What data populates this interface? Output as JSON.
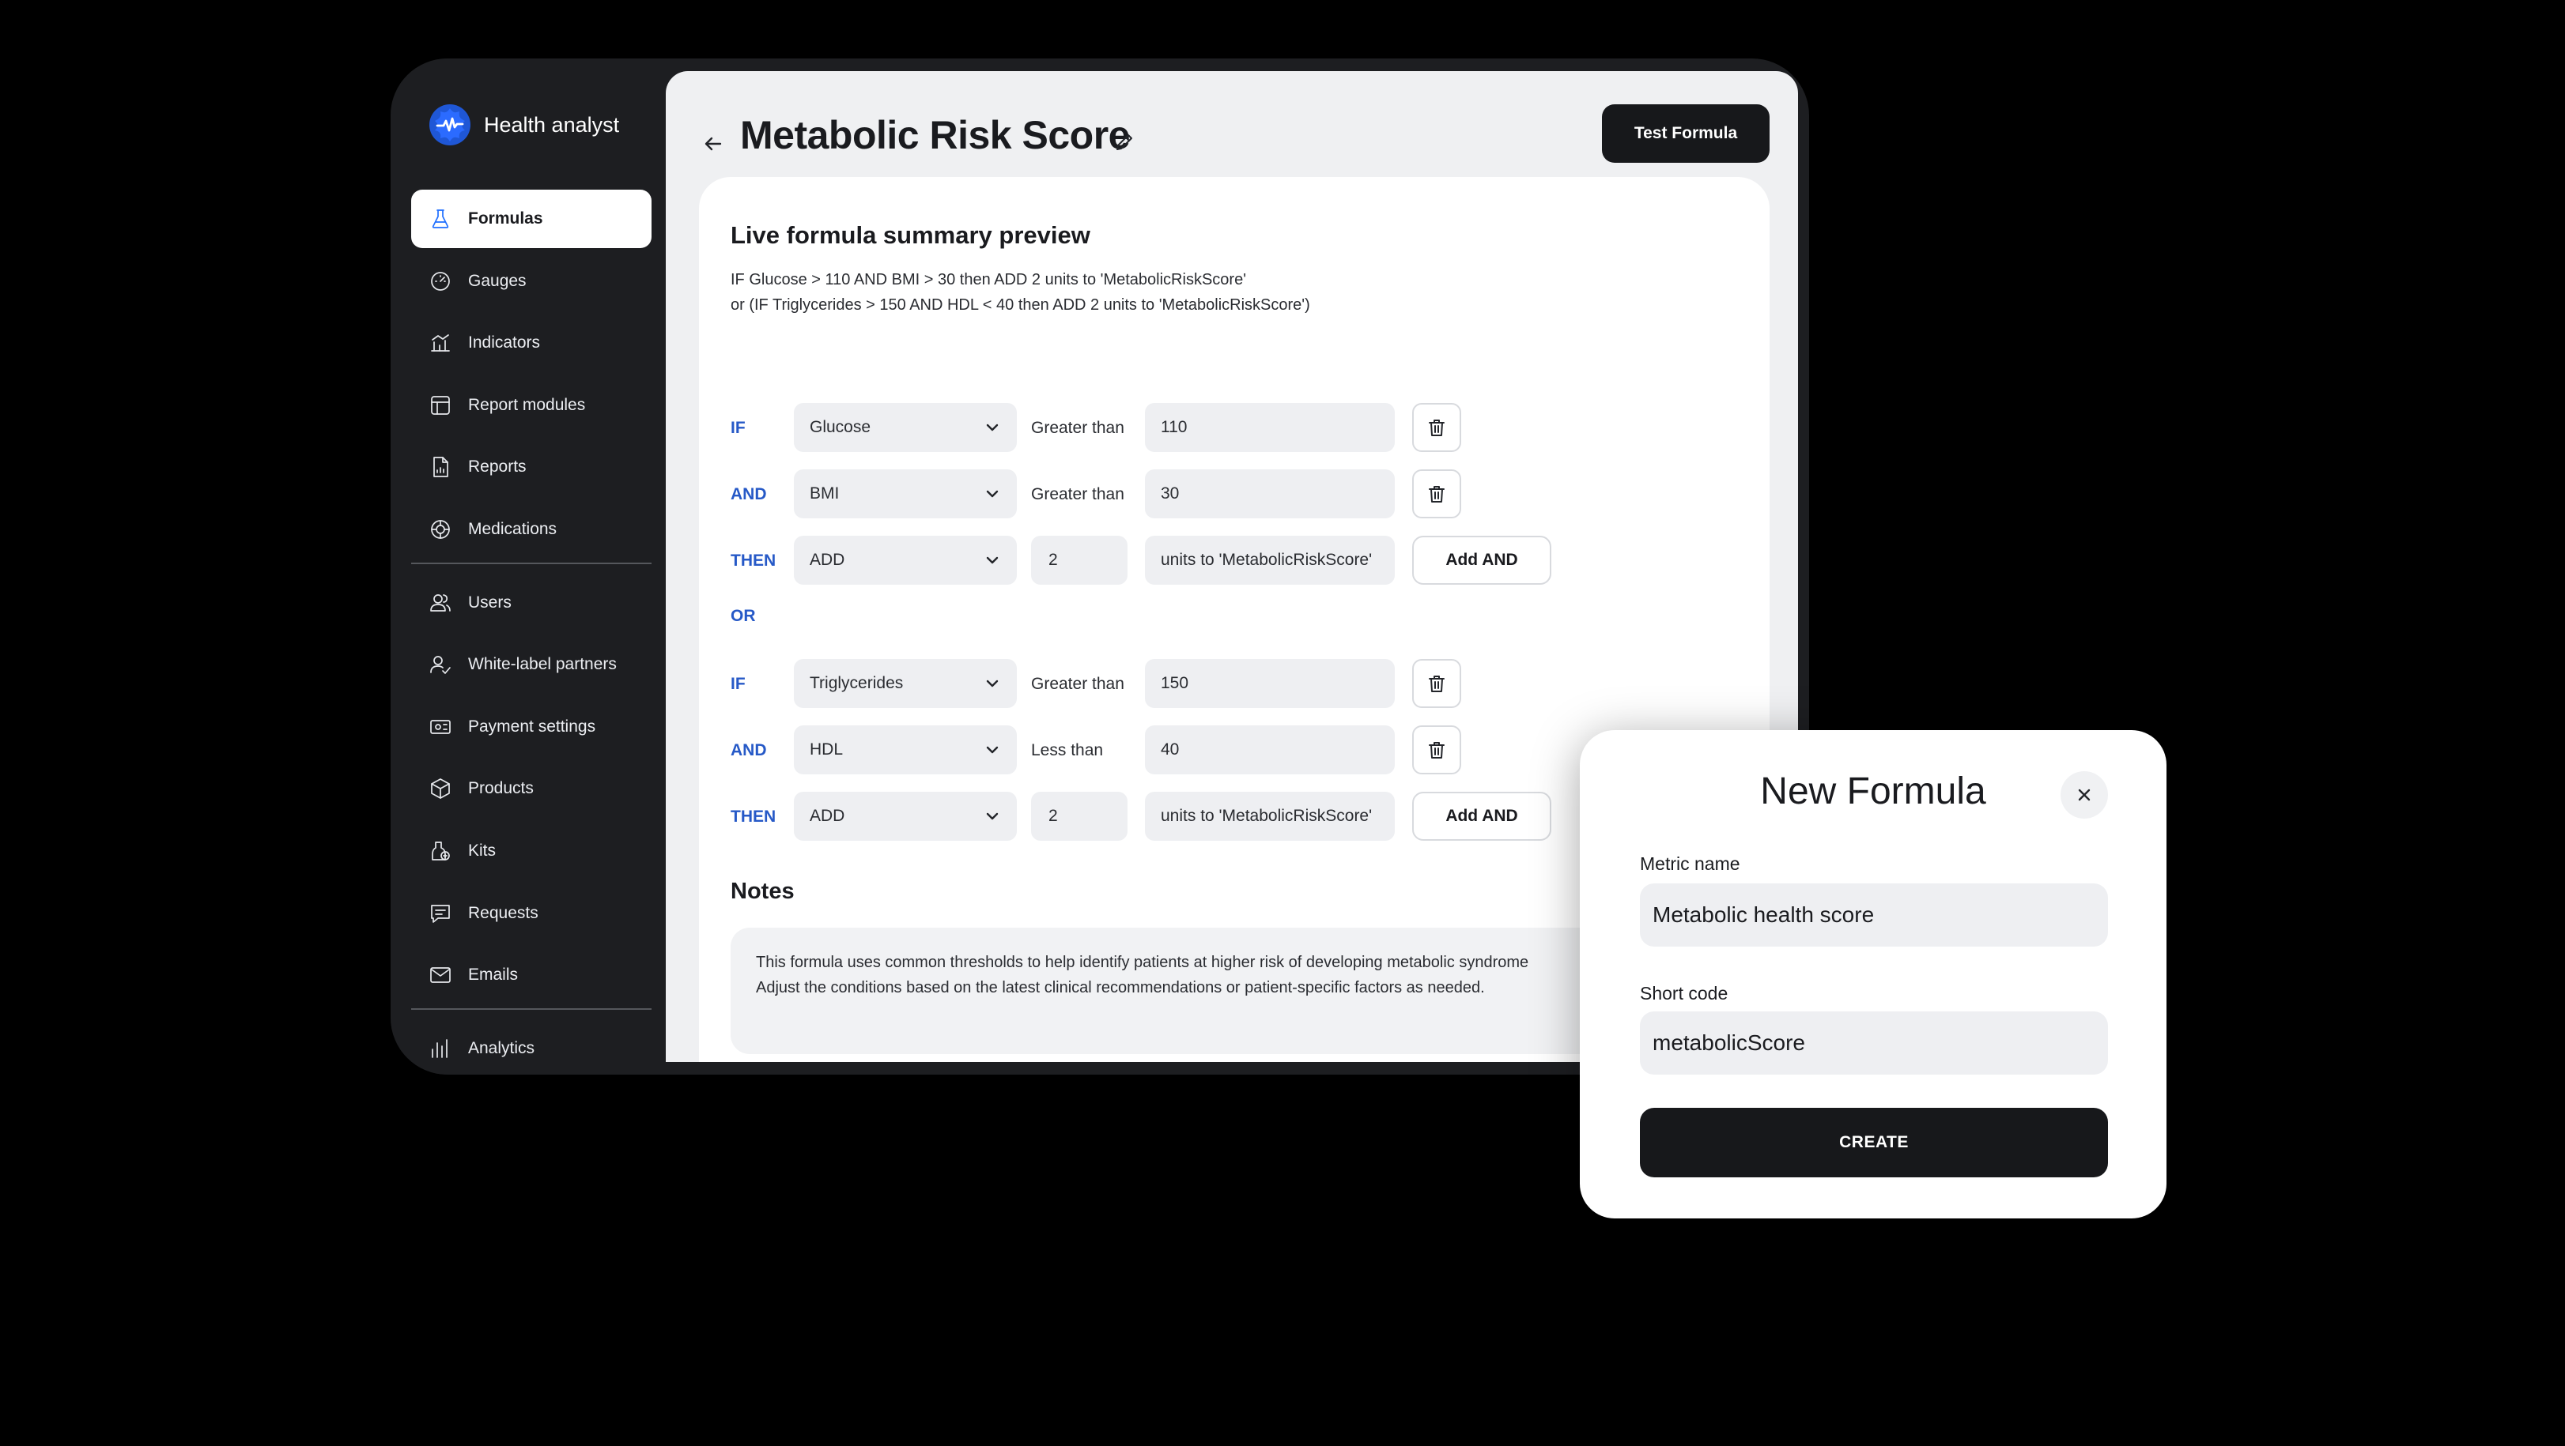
{
  "app": {
    "name": "Health analyst",
    "accent_color": "#1f6fff",
    "keyword_color": "#2659c7"
  },
  "sidebar": {
    "items": [
      {
        "label": "Formulas",
        "icon": "flask-icon",
        "active": true
      },
      {
        "label": "Gauges",
        "icon": "gauge-icon"
      },
      {
        "label": "Indicators",
        "icon": "indicators-icon"
      },
      {
        "label": "Report modules",
        "icon": "layout-icon"
      },
      {
        "label": "Reports",
        "icon": "report-icon"
      },
      {
        "label": "Medications",
        "icon": "medication-icon"
      },
      {
        "label": "Users",
        "icon": "users-icon"
      },
      {
        "label": "White-label partners",
        "icon": "partner-icon"
      },
      {
        "label": "Payment settings",
        "icon": "payment-icon"
      },
      {
        "label": "Products",
        "icon": "box-icon"
      },
      {
        "label": "Kits",
        "icon": "kit-icon"
      },
      {
        "label": "Requests",
        "icon": "request-icon"
      },
      {
        "label": "Emails",
        "icon": "mail-icon"
      },
      {
        "label": "Analytics",
        "icon": "analytics-icon"
      }
    ]
  },
  "header": {
    "title": "Metabolic Risk Score",
    "test_button": "Test Formula"
  },
  "preview": {
    "title": "Live formula summary preview",
    "line1": "IF Glucose > 110 AND BMI > 30 then ADD 2 units to 'MetabolicRiskScore'",
    "line2": "or (IF Triglycerides > 150 AND HDL < 40 then ADD 2 units to 'MetabolicRiskScore')"
  },
  "groups": [
    {
      "conditions": [
        {
          "keyword": "IF",
          "metric": "Glucose",
          "operator": "Greater than",
          "value": "110"
        },
        {
          "keyword": "AND",
          "metric": "BMI",
          "operator": "Greater than",
          "value": "30"
        }
      ],
      "action": {
        "keyword": "THEN",
        "op": "ADD",
        "amount": "2",
        "target": "units to 'MetabolicRiskScore'",
        "add_button": "Add AND"
      }
    },
    {
      "conditions": [
        {
          "keyword": "IF",
          "metric": "Triglycerides",
          "operator": "Greater than",
          "value": "150"
        },
        {
          "keyword": "AND",
          "metric": "HDL",
          "operator": "Less than",
          "value": "40"
        }
      ],
      "action": {
        "keyword": "THEN",
        "op": "ADD",
        "amount": "2",
        "target": "units to 'MetabolicRiskScore'",
        "add_button": "Add AND"
      }
    }
  ],
  "or_label": "OR",
  "notes": {
    "title": "Notes",
    "line1": "This formula uses common thresholds to help identify patients at higher risk of developing metabolic syndrome",
    "line2": "Adjust the conditions based on the latest clinical recommendations or patient-specific factors as needed."
  },
  "modal": {
    "title": "New Formula",
    "metric_label": "Metric name",
    "metric_value": "Metabolic health score",
    "code_label": "Short code",
    "code_value": "metabolicScore",
    "create_button": "CREATE"
  }
}
